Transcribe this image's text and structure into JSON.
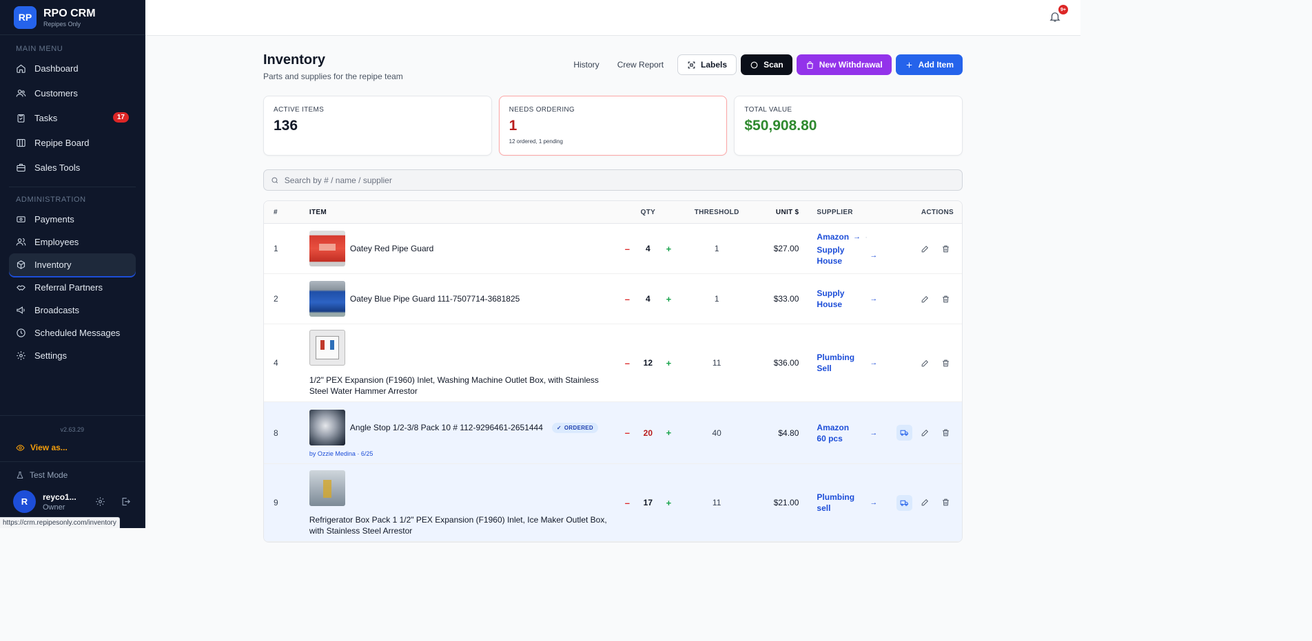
{
  "app": {
    "logo": "RP",
    "name": "RPO CRM",
    "tagline": "Repipes Only"
  },
  "sidebar": {
    "main_label": "MAIN MENU",
    "admin_label": "ADMINISTRATION",
    "main_items": [
      {
        "label": "Dashboard",
        "icon": "home-icon"
      },
      {
        "label": "Customers",
        "icon": "users-icon"
      },
      {
        "label": "Tasks",
        "icon": "clipboard-icon",
        "badge": "17"
      },
      {
        "label": "Repipe Board",
        "icon": "board-icon"
      },
      {
        "label": "Sales Tools",
        "icon": "briefcase-icon"
      }
    ],
    "admin_items": [
      {
        "label": "Payments",
        "icon": "payments-icon"
      },
      {
        "label": "Employees",
        "icon": "employees-icon"
      },
      {
        "label": "Inventory",
        "icon": "box-icon",
        "active": true
      },
      {
        "label": "Referral Partners",
        "icon": "handshake-icon"
      },
      {
        "label": "Broadcasts",
        "icon": "megaphone-icon"
      },
      {
        "label": "Scheduled Messages",
        "icon": "clock-icon"
      },
      {
        "label": "Settings",
        "icon": "gear-icon"
      }
    ],
    "version": "v2.63.29",
    "view_as": "View as...",
    "test_mode": "Test Mode",
    "user": {
      "initial": "R",
      "name": "reyco1...",
      "role": "Owner"
    }
  },
  "status_url": "https://crm.repipesonly.com/inventory",
  "topbar": {
    "notification_badge": "9+"
  },
  "page": {
    "title": "Inventory",
    "subtitle": "Parts and supplies for the repipe team",
    "actions": {
      "history": "History",
      "crew_report": "Crew Report",
      "labels": "Labels",
      "scan": "Scan",
      "new_withdrawal": "New Withdrawal",
      "add_item": "Add Item"
    }
  },
  "stats": {
    "active_label": "ACTIVE ITEMS",
    "active_value": "136",
    "needs_label": "NEEDS ORDERING",
    "needs_value": "1",
    "needs_note": "12 ordered, 1 pending",
    "total_label": "TOTAL VALUE",
    "total_value": "$50,908.80"
  },
  "colors": {
    "needs_red": "#b91c1c",
    "total_green": "#2f8a2f",
    "accent_blue": "#2563eb",
    "purple": "#9333ea"
  },
  "search": {
    "placeholder": "Search by # / name / supplier"
  },
  "table": {
    "headers": {
      "num": "#",
      "item": "ITEM",
      "qty": "QTY",
      "threshold": "THRESHOLD",
      "unit": "UNIT $",
      "supplier": "SUPPLIER",
      "actions": "ACTIONS"
    },
    "qty_minus": "–",
    "qty_plus": "+",
    "arrow": "→",
    "rows": [
      {
        "num": "1",
        "name": "Oatey Red Pipe Guard",
        "qty": "4",
        "threshold": "1",
        "unit": "$27.00",
        "supplier_1": "Amazon",
        "supplier_2": "Supply House"
      },
      {
        "num": "2",
        "name": "Oatey Blue Pipe Guard 111-7507714-3681825",
        "qty": "4",
        "threshold": "1",
        "unit": "$33.00",
        "supplier": "Supply House"
      },
      {
        "num": "4",
        "name": "1/2\" PEX Expansion (F1960) Inlet, Washing Machine Outlet Box, with Stainless Steel Water Hammer Arrestor",
        "qty": "12",
        "threshold": "11",
        "unit": "$36.00",
        "supplier": "Plumbing Sell"
      },
      {
        "num": "8",
        "name": "Angle Stop 1/2-3/8 Pack 10 # 112-9296461-2651444",
        "badge": "ORDERED",
        "by": "by Ozzie Medina · 6/25",
        "qty": "20",
        "threshold": "40",
        "unit": "$4.80",
        "supplier": "Amazon 60 pcs"
      },
      {
        "num": "9",
        "name": "Refrigerator Box Pack 1 1/2\" PEX Expansion (F1960) Inlet, Ice Maker Outlet Box, with Stainless Steel Arrestor",
        "qty": "17",
        "threshold": "11",
        "unit": "$21.00",
        "supplier": "Plumbing sell"
      }
    ]
  }
}
